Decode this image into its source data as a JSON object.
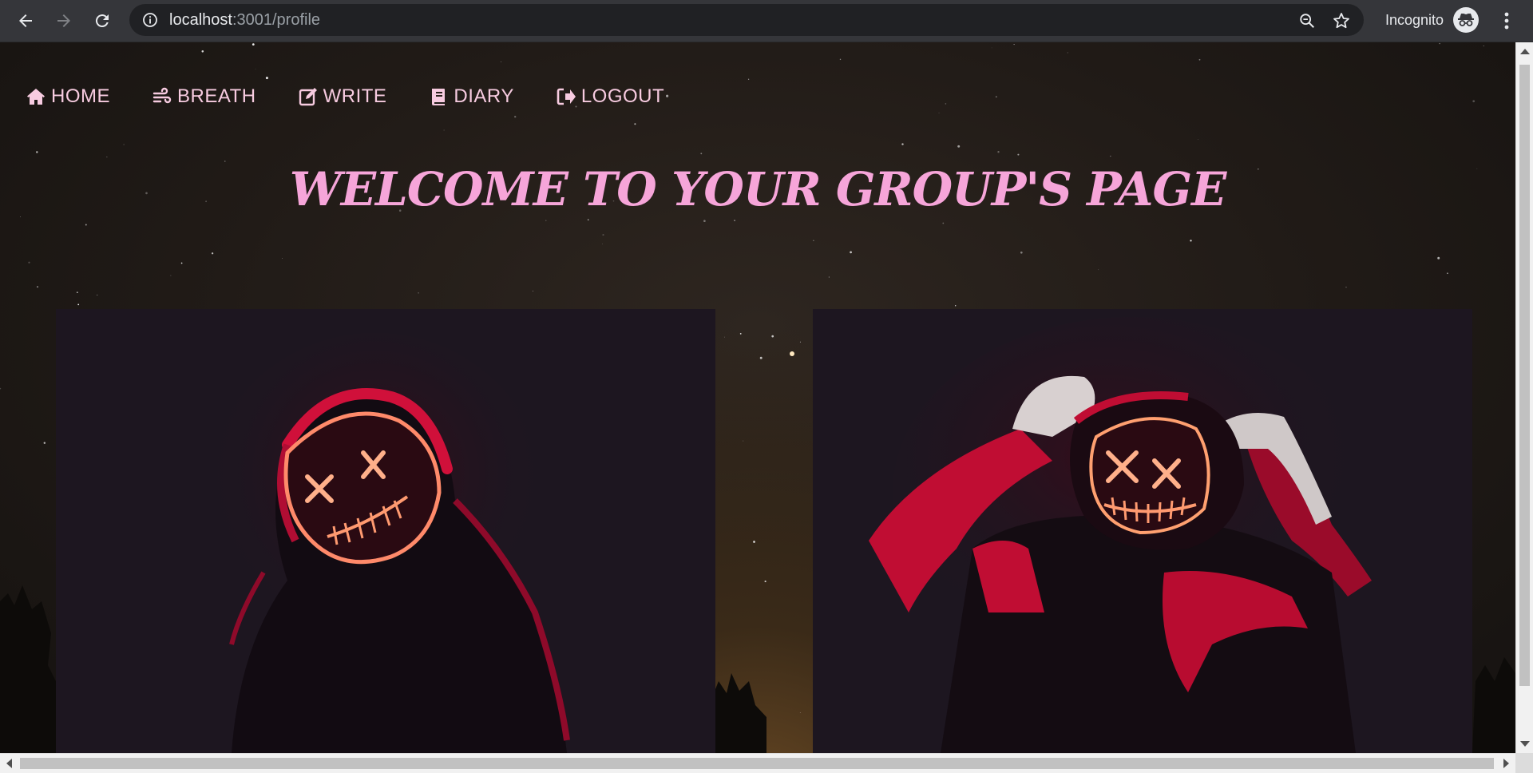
{
  "browser": {
    "url_host": "localhost",
    "url_path": ":3001/profile",
    "incognito_label": "Incognito",
    "icons": [
      "back-icon",
      "forward-icon",
      "reload-icon",
      "info-icon",
      "zoom-icon",
      "star-icon",
      "incognito-icon",
      "kebab-menu-icon"
    ]
  },
  "nav": {
    "items": [
      {
        "label": "HOME",
        "icon": "home-icon"
      },
      {
        "label": "BREATH",
        "icon": "wind-icon"
      },
      {
        "label": "WRITE",
        "icon": "edit-icon"
      },
      {
        "label": "DIARY",
        "icon": "book-icon"
      },
      {
        "label": "LOGOUT",
        "icon": "sign-out-icon"
      }
    ]
  },
  "main": {
    "title": "WELCOME TO YOUR GROUP'S PAGE"
  },
  "colors": {
    "nav_text": "#f7cbe0",
    "title": "#f6a5d9",
    "photo_bg": "#1d1620",
    "neon_red": "#e0103c",
    "neon_orange": "#ff9a66"
  }
}
